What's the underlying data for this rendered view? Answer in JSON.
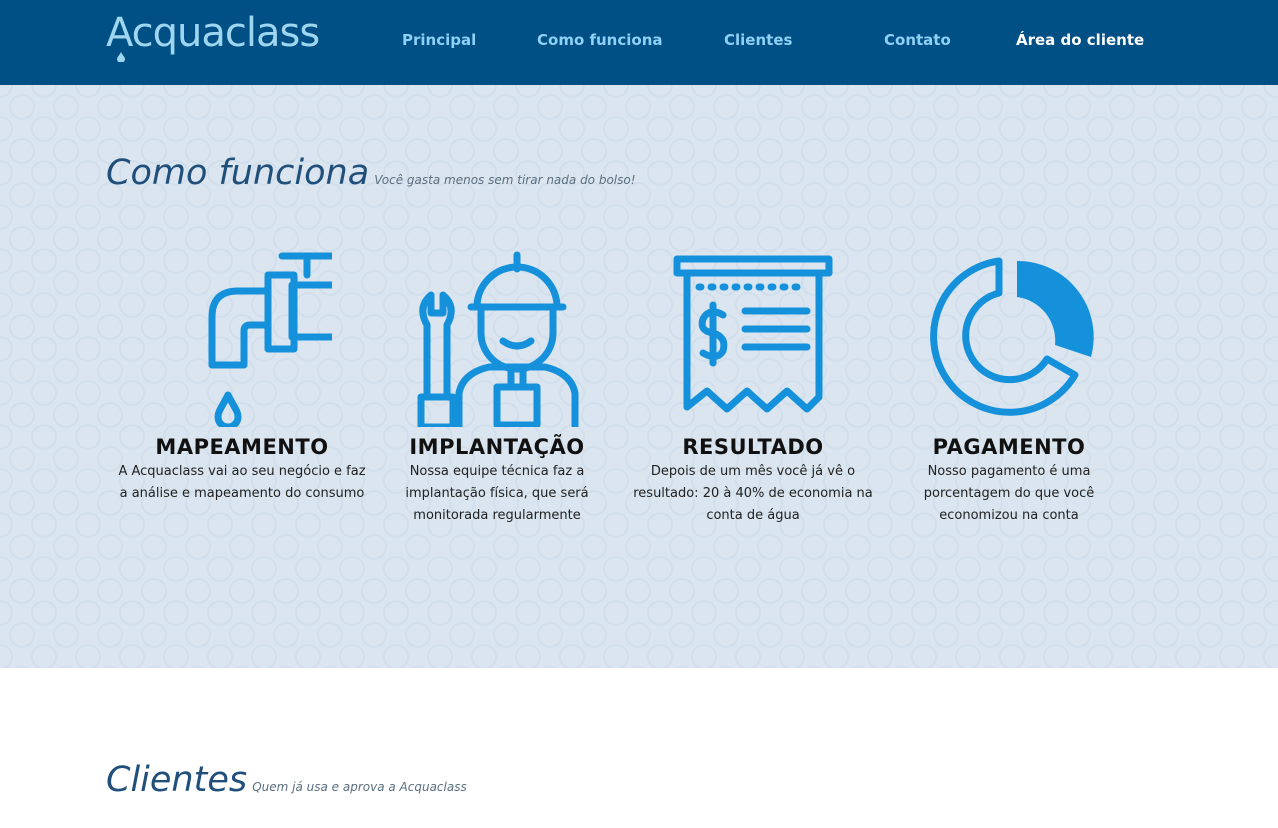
{
  "brand": {
    "logo_text": "Acquaclass"
  },
  "nav": {
    "items": [
      "Principal",
      "Como funciona",
      "Clientes",
      "Contato"
    ],
    "client_area": "Área do cliente"
  },
  "how_it_works": {
    "title": "Como funciona",
    "subtitle": "Você gasta menos sem tirar nada do bolso!",
    "steps": [
      {
        "title": "MAPEAMENTO",
        "text": "A Acquaclass vai ao seu negócio e faz a análise e mapeamento do consumo",
        "icon": "faucet-icon"
      },
      {
        "title": "IMPLANTAÇÃO",
        "text": "Nossa equipe técnica faz a implantação física, que será monitorada regularmente",
        "icon": "technician-icon"
      },
      {
        "title": "RESULTADO",
        "text": "Depois de um mês você já vê o resultado: 20 à 40% de economia na conta de água",
        "icon": "receipt-icon"
      },
      {
        "title": "PAGAMENTO",
        "text": "Nosso pagamento é uma porcentagem do que você economizou na conta",
        "icon": "pie-chart-icon"
      }
    ]
  },
  "clients": {
    "title": "Clientes",
    "subtitle": "Quem já usa e aprova a Acquaclass"
  },
  "colors": {
    "header_bg": "#004f85",
    "nav_link": "#8fd0f5",
    "icon_blue": "#1591dc",
    "hero_bg": "#dae5ef"
  }
}
